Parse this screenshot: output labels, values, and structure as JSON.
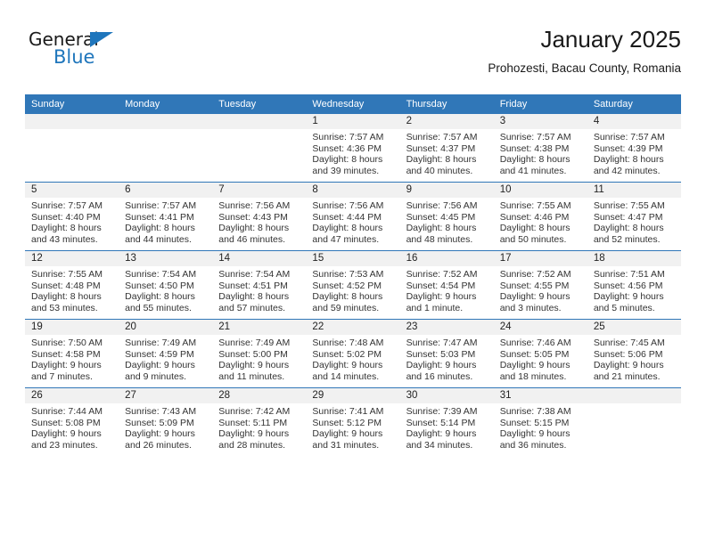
{
  "brand": {
    "name_part1": "General",
    "name_part2": "Blue",
    "triangle_color": "#1f76bc"
  },
  "header": {
    "title": "January 2025",
    "subtitle": "Prohozesti, Bacau County, Romania"
  },
  "theme": {
    "header_blue": "#3077b8",
    "daynum_band": "#f1f1f1",
    "row_divider": "#3077b8",
    "text": "#333333"
  },
  "weekdays": [
    "Sunday",
    "Monday",
    "Tuesday",
    "Wednesday",
    "Thursday",
    "Friday",
    "Saturday"
  ],
  "labels": {
    "sunrise_prefix": "Sunrise:",
    "sunset_prefix": "Sunset:",
    "daylight_prefix": "Daylight:"
  },
  "weeks": [
    [
      {
        "day": "",
        "sunrise": "",
        "sunset": "",
        "daylight1": "",
        "daylight2": ""
      },
      {
        "day": "",
        "sunrise": "",
        "sunset": "",
        "daylight1": "",
        "daylight2": ""
      },
      {
        "day": "",
        "sunrise": "",
        "sunset": "",
        "daylight1": "",
        "daylight2": ""
      },
      {
        "day": "1",
        "sunrise": "Sunrise: 7:57 AM",
        "sunset": "Sunset: 4:36 PM",
        "daylight1": "Daylight: 8 hours",
        "daylight2": "and 39 minutes."
      },
      {
        "day": "2",
        "sunrise": "Sunrise: 7:57 AM",
        "sunset": "Sunset: 4:37 PM",
        "daylight1": "Daylight: 8 hours",
        "daylight2": "and 40 minutes."
      },
      {
        "day": "3",
        "sunrise": "Sunrise: 7:57 AM",
        "sunset": "Sunset: 4:38 PM",
        "daylight1": "Daylight: 8 hours",
        "daylight2": "and 41 minutes."
      },
      {
        "day": "4",
        "sunrise": "Sunrise: 7:57 AM",
        "sunset": "Sunset: 4:39 PM",
        "daylight1": "Daylight: 8 hours",
        "daylight2": "and 42 minutes."
      }
    ],
    [
      {
        "day": "5",
        "sunrise": "Sunrise: 7:57 AM",
        "sunset": "Sunset: 4:40 PM",
        "daylight1": "Daylight: 8 hours",
        "daylight2": "and 43 minutes."
      },
      {
        "day": "6",
        "sunrise": "Sunrise: 7:57 AM",
        "sunset": "Sunset: 4:41 PM",
        "daylight1": "Daylight: 8 hours",
        "daylight2": "and 44 minutes."
      },
      {
        "day": "7",
        "sunrise": "Sunrise: 7:56 AM",
        "sunset": "Sunset: 4:43 PM",
        "daylight1": "Daylight: 8 hours",
        "daylight2": "and 46 minutes."
      },
      {
        "day": "8",
        "sunrise": "Sunrise: 7:56 AM",
        "sunset": "Sunset: 4:44 PM",
        "daylight1": "Daylight: 8 hours",
        "daylight2": "and 47 minutes."
      },
      {
        "day": "9",
        "sunrise": "Sunrise: 7:56 AM",
        "sunset": "Sunset: 4:45 PM",
        "daylight1": "Daylight: 8 hours",
        "daylight2": "and 48 minutes."
      },
      {
        "day": "10",
        "sunrise": "Sunrise: 7:55 AM",
        "sunset": "Sunset: 4:46 PM",
        "daylight1": "Daylight: 8 hours",
        "daylight2": "and 50 minutes."
      },
      {
        "day": "11",
        "sunrise": "Sunrise: 7:55 AM",
        "sunset": "Sunset: 4:47 PM",
        "daylight1": "Daylight: 8 hours",
        "daylight2": "and 52 minutes."
      }
    ],
    [
      {
        "day": "12",
        "sunrise": "Sunrise: 7:55 AM",
        "sunset": "Sunset: 4:48 PM",
        "daylight1": "Daylight: 8 hours",
        "daylight2": "and 53 minutes."
      },
      {
        "day": "13",
        "sunrise": "Sunrise: 7:54 AM",
        "sunset": "Sunset: 4:50 PM",
        "daylight1": "Daylight: 8 hours",
        "daylight2": "and 55 minutes."
      },
      {
        "day": "14",
        "sunrise": "Sunrise: 7:54 AM",
        "sunset": "Sunset: 4:51 PM",
        "daylight1": "Daylight: 8 hours",
        "daylight2": "and 57 minutes."
      },
      {
        "day": "15",
        "sunrise": "Sunrise: 7:53 AM",
        "sunset": "Sunset: 4:52 PM",
        "daylight1": "Daylight: 8 hours",
        "daylight2": "and 59 minutes."
      },
      {
        "day": "16",
        "sunrise": "Sunrise: 7:52 AM",
        "sunset": "Sunset: 4:54 PM",
        "daylight1": "Daylight: 9 hours",
        "daylight2": "and 1 minute."
      },
      {
        "day": "17",
        "sunrise": "Sunrise: 7:52 AM",
        "sunset": "Sunset: 4:55 PM",
        "daylight1": "Daylight: 9 hours",
        "daylight2": "and 3 minutes."
      },
      {
        "day": "18",
        "sunrise": "Sunrise: 7:51 AM",
        "sunset": "Sunset: 4:56 PM",
        "daylight1": "Daylight: 9 hours",
        "daylight2": "and 5 minutes."
      }
    ],
    [
      {
        "day": "19",
        "sunrise": "Sunrise: 7:50 AM",
        "sunset": "Sunset: 4:58 PM",
        "daylight1": "Daylight: 9 hours",
        "daylight2": "and 7 minutes."
      },
      {
        "day": "20",
        "sunrise": "Sunrise: 7:49 AM",
        "sunset": "Sunset: 4:59 PM",
        "daylight1": "Daylight: 9 hours",
        "daylight2": "and 9 minutes."
      },
      {
        "day": "21",
        "sunrise": "Sunrise: 7:49 AM",
        "sunset": "Sunset: 5:00 PM",
        "daylight1": "Daylight: 9 hours",
        "daylight2": "and 11 minutes."
      },
      {
        "day": "22",
        "sunrise": "Sunrise: 7:48 AM",
        "sunset": "Sunset: 5:02 PM",
        "daylight1": "Daylight: 9 hours",
        "daylight2": "and 14 minutes."
      },
      {
        "day": "23",
        "sunrise": "Sunrise: 7:47 AM",
        "sunset": "Sunset: 5:03 PM",
        "daylight1": "Daylight: 9 hours",
        "daylight2": "and 16 minutes."
      },
      {
        "day": "24",
        "sunrise": "Sunrise: 7:46 AM",
        "sunset": "Sunset: 5:05 PM",
        "daylight1": "Daylight: 9 hours",
        "daylight2": "and 18 minutes."
      },
      {
        "day": "25",
        "sunrise": "Sunrise: 7:45 AM",
        "sunset": "Sunset: 5:06 PM",
        "daylight1": "Daylight: 9 hours",
        "daylight2": "and 21 minutes."
      }
    ],
    [
      {
        "day": "26",
        "sunrise": "Sunrise: 7:44 AM",
        "sunset": "Sunset: 5:08 PM",
        "daylight1": "Daylight: 9 hours",
        "daylight2": "and 23 minutes."
      },
      {
        "day": "27",
        "sunrise": "Sunrise: 7:43 AM",
        "sunset": "Sunset: 5:09 PM",
        "daylight1": "Daylight: 9 hours",
        "daylight2": "and 26 minutes."
      },
      {
        "day": "28",
        "sunrise": "Sunrise: 7:42 AM",
        "sunset": "Sunset: 5:11 PM",
        "daylight1": "Daylight: 9 hours",
        "daylight2": "and 28 minutes."
      },
      {
        "day": "29",
        "sunrise": "Sunrise: 7:41 AM",
        "sunset": "Sunset: 5:12 PM",
        "daylight1": "Daylight: 9 hours",
        "daylight2": "and 31 minutes."
      },
      {
        "day": "30",
        "sunrise": "Sunrise: 7:39 AM",
        "sunset": "Sunset: 5:14 PM",
        "daylight1": "Daylight: 9 hours",
        "daylight2": "and 34 minutes."
      },
      {
        "day": "31",
        "sunrise": "Sunrise: 7:38 AM",
        "sunset": "Sunset: 5:15 PM",
        "daylight1": "Daylight: 9 hours",
        "daylight2": "and 36 minutes."
      },
      {
        "day": "",
        "sunrise": "",
        "sunset": "",
        "daylight1": "",
        "daylight2": ""
      }
    ]
  ]
}
